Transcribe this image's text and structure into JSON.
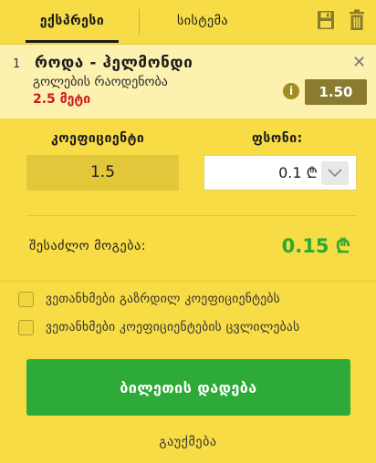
{
  "tabs": {
    "express": "ექსპრესი",
    "system": "სისტემა"
  },
  "icons": {
    "save": "save-icon",
    "trash": "trash-icon",
    "close": "close-icon",
    "info": "info-icon",
    "dropdown": "chevron-down-icon"
  },
  "bet": {
    "index": "1",
    "title": "როდა - ჰელმონდი",
    "market": "გოლების რაოდენობა",
    "selection": "2.5 მეტი",
    "odds": "1.50",
    "close_glyph": "✕",
    "info_glyph": "i"
  },
  "form": {
    "coef_label": "კოეფიციენტი",
    "coef_value": "1.5",
    "stake_label": "ფსონი:",
    "stake_value": "0.1 ₾"
  },
  "summary": {
    "win_label": "შესაძლო მოგება:",
    "win_value": "0.15 ₾"
  },
  "options": {
    "accept_increase": "ვეთანხმები გაზრდილ კოეფიციენტებს",
    "accept_change": "ვეთანხმები კოეფიციენტების ცვლილებას"
  },
  "actions": {
    "place_bet": "ბილეთის დადება",
    "cancel": "გაუქმება"
  },
  "colors": {
    "background": "#f7dc46",
    "card": "#fdf1b0",
    "accent_green": "#2eaa39",
    "win_green": "#2aaa2e",
    "selection_red": "#d0161e",
    "odds_badge": "#8a7b2e"
  }
}
